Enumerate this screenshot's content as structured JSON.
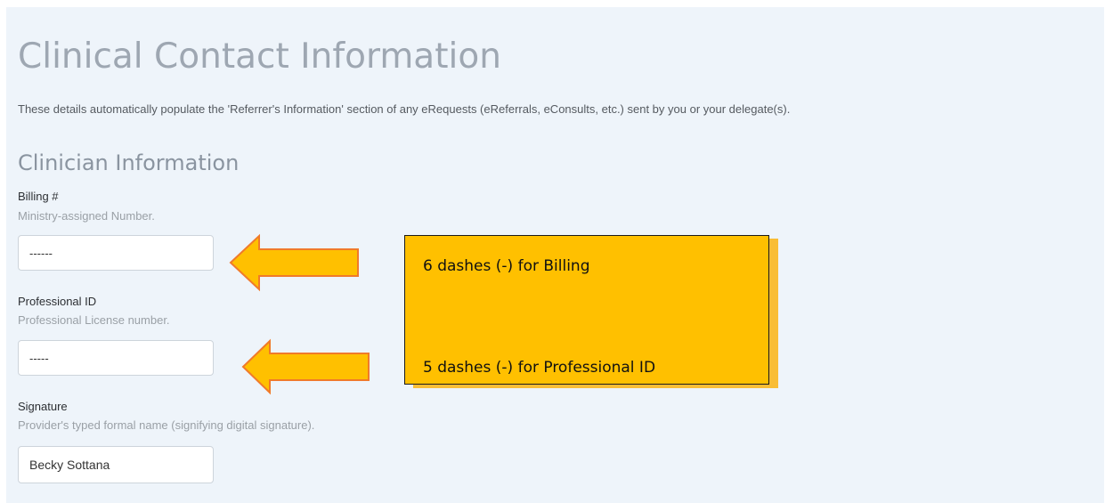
{
  "page": {
    "title": "Clinical Contact Information",
    "description": "These details automatically populate the 'Referrer's Information' section of any eRequests (eReferrals, eConsults, etc.) sent by you or your delegate(s)."
  },
  "section": {
    "heading": "Clinician Information"
  },
  "fields": {
    "billing": {
      "label": "Billing #",
      "help": "Ministry-assigned Number.",
      "value": "------"
    },
    "professional_id": {
      "label": "Professional ID",
      "help": "Professional License number.",
      "value": "-----"
    },
    "signature": {
      "label": "Signature",
      "help": "Provider's typed formal name (signifying digital signature).",
      "value": "Becky Sottana"
    }
  },
  "callout": {
    "line1": "6 dashes (-) for Billing",
    "line2": "5 dashes (-) for Professional ID"
  },
  "colors": {
    "panel_background": "#eef4fa",
    "callout_fill": "#ffc000",
    "arrow_fill": "#ffc000",
    "arrow_outline": "#f07a2a"
  }
}
